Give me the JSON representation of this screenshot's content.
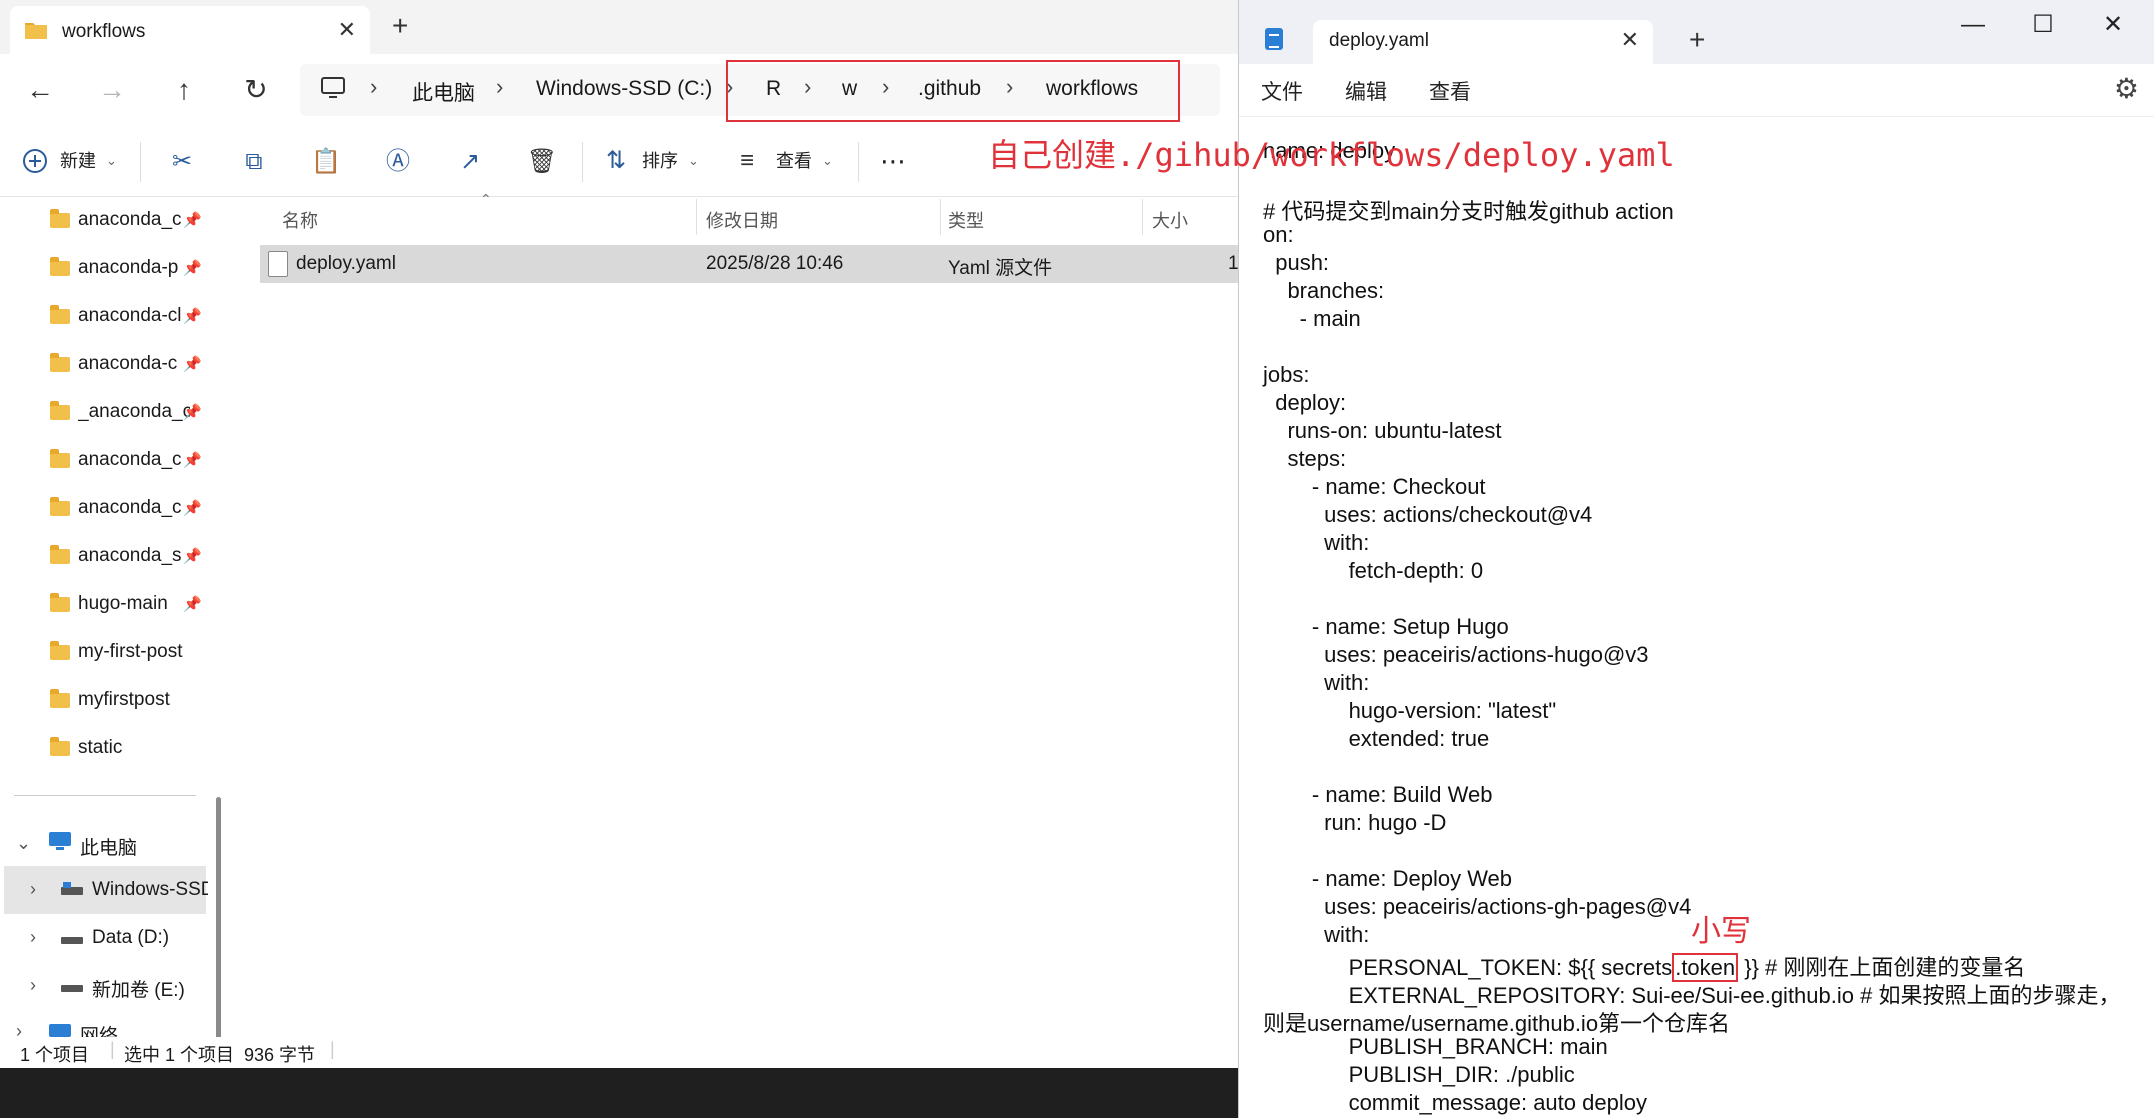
{
  "explorer": {
    "tab_title": "workflows",
    "tab_close": "✕",
    "new_tab": "+",
    "nav": {
      "back": "←",
      "forward": "→",
      "up": "↑",
      "refresh": "↻"
    },
    "breadcrumb": [
      "此电脑",
      "Windows-SSD (C:)",
      "R",
      "w",
      ".github",
      "workflows"
    ],
    "crumb_sep": "›",
    "toolbar": {
      "new_label": "新建",
      "sort_label": "排序",
      "view_label": "查看",
      "more": "⋯"
    },
    "annotation_path": "自己创建./gihub/workflows/deploy.yaml",
    "sidebar": {
      "quick_access": [
        "anaconda_c",
        "anaconda-p",
        "anaconda-cl",
        "anaconda-c",
        "_anaconda_c",
        "anaconda_c",
        "anaconda_c",
        "anaconda_s",
        "hugo-main",
        "my-first-post",
        "myfirstpost",
        "static"
      ],
      "this_pc": "此电脑",
      "drives": [
        "Windows-SSD",
        "Data (D:)",
        "新加卷 (E:)"
      ],
      "network": "网络"
    },
    "columns": {
      "name": "名称",
      "modified": "修改日期",
      "type": "类型",
      "size": "大小"
    },
    "files": [
      {
        "name": "deploy.yaml",
        "modified": "2025/8/28 10:46",
        "type": "Yaml 源文件",
        "size": "1"
      }
    ],
    "status": {
      "count": "1 个项目",
      "selection": "选中 1 个项目  936 字节"
    }
  },
  "notepad": {
    "tab_title": "deploy.yaml",
    "tab_close": "✕",
    "new_tab": "+",
    "window_buttons": {
      "minimize": "—",
      "maximize": "☐",
      "close": "✕"
    },
    "menu": [
      "文件",
      "编辑",
      "查看"
    ],
    "settings_icon": "⚙",
    "annotation_lower": "小写",
    "lines": [
      "name: deploy",
      "",
      "# 代码提交到main分支时触发github action",
      "on:",
      "  push:",
      "    branches:",
      "      - main",
      "",
      "jobs:",
      "  deploy:",
      "    runs-on: ubuntu-latest",
      "    steps:",
      "        - name: Checkout",
      "          uses: actions/checkout@v4",
      "          with:",
      "              fetch-depth: 0",
      "",
      "        - name: Setup Hugo",
      "          uses: peaceiris/actions-hugo@v3",
      "          with:",
      "              hugo-version: \"latest\"",
      "              extended: true",
      "",
      "        - name: Build Web",
      "          run: hugo -D",
      "",
      "        - name: Deploy Web",
      "          uses: peaceiris/actions-gh-pages@v4",
      "          with:"
    ],
    "token_line": {
      "before": "              PERSONAL_TOKEN: ${{ secrets",
      "boxed": ".token",
      "after": " }} # 刚刚在上面创建的变量名"
    },
    "lines_after": [
      "              EXTERNAL_REPOSITORY: Sui-ee/Sui-ee.github.io # 如果按照上面的步骤走，",
      "则是username/username.github.io第一个仓库名",
      "              PUBLISH_BRANCH: main",
      "              PUBLISH_DIR: ./public",
      "              commit_message: auto deploy"
    ]
  }
}
